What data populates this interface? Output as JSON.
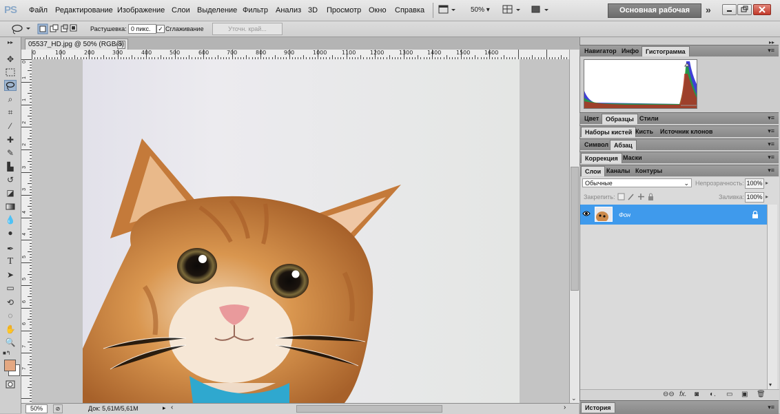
{
  "app": {
    "logo": "PS"
  },
  "menu": [
    "Файл",
    "Редактирование",
    "Изображение",
    "Слои",
    "Выделение",
    "Фильтр",
    "Анализ",
    "3D",
    "Просмотр",
    "Окно",
    "Справка"
  ],
  "menubar_controls": {
    "zoom": "50%"
  },
  "workspace": {
    "label": "Основная рабочая среда",
    "more": "»"
  },
  "options": {
    "feather_label": "Растушевка:",
    "feather_value": "0 пикс.",
    "antialias_label": "Сглаживание",
    "antialias_checked": true,
    "refine_label": "Уточн. край..."
  },
  "document": {
    "tab_title": "05537_HD.jpg @ 50% (RGB/8)",
    "close": "×"
  },
  "ruler_h_labels": [
    "0",
    "100",
    "200",
    "300",
    "400",
    "500",
    "600",
    "700",
    "800",
    "900",
    "1000",
    "1100",
    "1200",
    "1300",
    "1400",
    "1500",
    "1600"
  ],
  "ruler_v_labels": [
    "0",
    "1",
    "1",
    "2",
    "2",
    "3",
    "3",
    "4",
    "4",
    "5",
    "5",
    "6",
    "6",
    "7",
    "7"
  ],
  "status": {
    "zoom": "50%",
    "doc_info": "Док: 5,61M/5,61M"
  },
  "panels": {
    "group1_tabs": [
      "Навигатор",
      "Инфо",
      "Гистограмма"
    ],
    "group2_tabs": [
      "Цвет",
      "Образцы",
      "Стили"
    ],
    "group3_tabs": [
      "Наборы кистей",
      "Кисть",
      "Источник клонов"
    ],
    "group4_tabs": [
      "Символ",
      "Абзац"
    ],
    "group5_tabs": [
      "Коррекция",
      "Маски"
    ],
    "group6_tabs": [
      "Слои",
      "Каналы",
      "Контуры"
    ],
    "layers": {
      "blend_mode": "Обычные",
      "opacity_label": "Непрозрачность:",
      "opacity_value": "100%",
      "lock_label": "Закрепить:",
      "fill_label": "Заливка:",
      "fill_value": "100%",
      "items": [
        {
          "name": "Фон",
          "locked": true,
          "visible": true
        }
      ]
    },
    "history_tab": "История"
  },
  "colors": {
    "foreground": "#e4a882",
    "background": "#ffffff",
    "layer_selected": "#3f9aec",
    "workspace_button": "#7a7a7a"
  }
}
